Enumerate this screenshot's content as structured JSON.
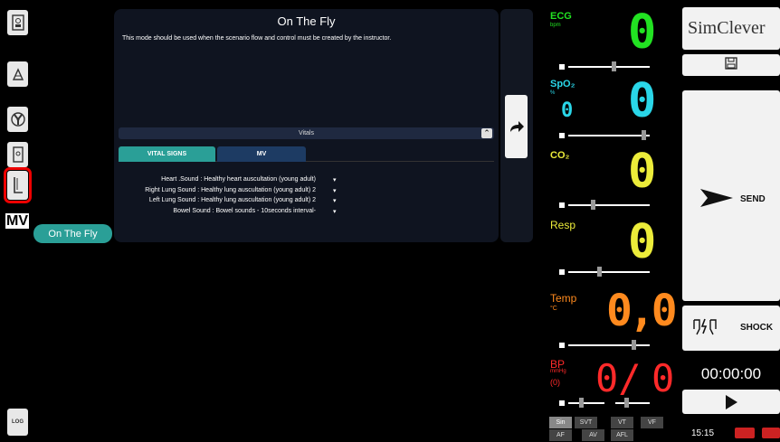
{
  "sidebar": {
    "mv_label": "MV",
    "log_label": "LOG",
    "scenario_mode": "On The Fly"
  },
  "center": {
    "title": "On The Fly",
    "description": "This mode should be used when the scenario flow and control must be created by the instructor.",
    "vitals_bar_label": "Vitals",
    "tabs": [
      {
        "label": "VITAL SIGNS",
        "active": true
      },
      {
        "label": "MV",
        "active": false
      }
    ],
    "sounds": [
      {
        "label": "Heart .Sound : Healthy heart auscultation (young adult)",
        "dropdown": "▾"
      },
      {
        "label": "Right Lung Sound : Healthy lung auscultation (young adult) 2",
        "dropdown": "▾"
      },
      {
        "label": "Left Lung Sound : Healthy lung auscultation (young adult) 2",
        "dropdown": "▾"
      },
      {
        "label": "Bowel Sound : Bowel sounds - 10seconds interval-",
        "dropdown": "▾"
      }
    ]
  },
  "monitor": {
    "ecg": {
      "label": "ECG",
      "unit": "bpm",
      "value": "0",
      "color": "#22e222"
    },
    "spo2": {
      "label": "SpO₂",
      "unit": "%",
      "value": "0",
      "small_value": "0",
      "color": "#2ad6e8"
    },
    "co2": {
      "label": "CO₂",
      "value": "0",
      "color": "#ecec3a"
    },
    "resp": {
      "label": "Resp",
      "value": "0",
      "color": "#ecec3a"
    },
    "temp": {
      "label": "Temp",
      "unit": "°C",
      "value": "0,0",
      "color": "#ff8a1e"
    },
    "bp": {
      "label": "BP",
      "unit": "mmHg",
      "sub": "(0)",
      "systolic": "0/",
      "diastolic": "0",
      "color": "#ff2a2a"
    },
    "rhythms_row1": [
      "Sin",
      "SVT",
      "VT",
      "VF"
    ],
    "rhythms_row2": [
      "AF",
      "AV",
      "AFL"
    ]
  },
  "controls": {
    "brand": "SimClever",
    "send_label": "SEND",
    "shock_label": "SHOCK",
    "timer": "00:00:00",
    "clock": "15:15"
  }
}
